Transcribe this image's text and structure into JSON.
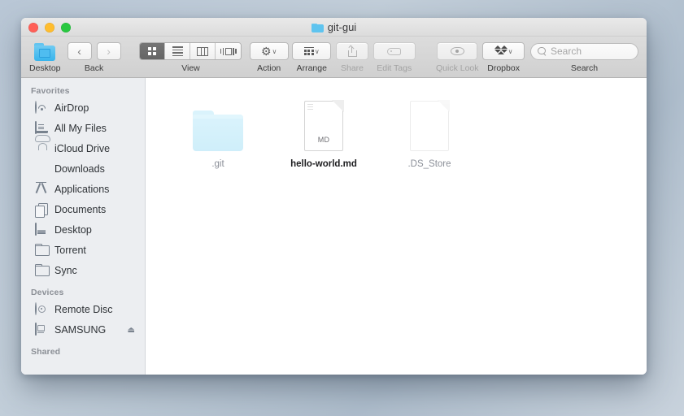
{
  "window": {
    "title": "git-gui",
    "title_icon": "folder-icon",
    "traffic_lights": [
      {
        "name": "close",
        "color": "#ff5f57"
      },
      {
        "name": "minimize",
        "color": "#ffbd2e"
      },
      {
        "name": "zoom",
        "color": "#28c840"
      }
    ]
  },
  "toolbar": {
    "proxy": {
      "label": "Desktop",
      "icon": "folder-icon"
    },
    "nav": {
      "label": "Back",
      "back_icon": "chevron-left-icon",
      "forward_icon": "chevron-right-icon",
      "back_glyph": "‹",
      "forward_glyph": "›"
    },
    "view": {
      "label": "View",
      "options": [
        {
          "name": "icon-view",
          "selected": true
        },
        {
          "name": "list-view",
          "selected": false
        },
        {
          "name": "column-view",
          "selected": false
        },
        {
          "name": "coverflow-view",
          "selected": false
        }
      ]
    },
    "action": {
      "label": "Action",
      "icon": "gear-icon",
      "caret": "∨"
    },
    "arrange": {
      "label": "Arrange",
      "icon": "grid-icon",
      "caret": "∨"
    },
    "share": {
      "label": "Share",
      "icon": "share-icon",
      "disabled": true
    },
    "edit_tags": {
      "label": "Edit Tags",
      "icon": "tag-icon",
      "disabled": true
    },
    "quick_look": {
      "label": "Quick Look",
      "icon": "eye-icon",
      "disabled": true
    },
    "dropbox": {
      "label": "Dropbox",
      "icon": "dropbox-icon",
      "caret": "∨"
    },
    "search": {
      "label": "Search",
      "placeholder": "Search",
      "value": "",
      "icon": "search-icon"
    }
  },
  "sidebar": {
    "sections": [
      {
        "header": "Favorites",
        "items": [
          {
            "label": "AirDrop",
            "icon": "airdrop-icon"
          },
          {
            "label": "All My Files",
            "icon": "all-my-files-icon"
          },
          {
            "label": "iCloud Drive",
            "icon": "cloud-icon"
          },
          {
            "label": "Downloads",
            "icon": "download-icon"
          },
          {
            "label": "Applications",
            "icon": "applications-icon"
          },
          {
            "label": "Documents",
            "icon": "documents-icon"
          },
          {
            "label": "Desktop",
            "icon": "desktop-icon"
          },
          {
            "label": "Torrent",
            "icon": "folder-icon"
          },
          {
            "label": "Sync",
            "icon": "folder-icon"
          }
        ]
      },
      {
        "header": "Devices",
        "items": [
          {
            "label": "Remote Disc",
            "icon": "disc-icon"
          },
          {
            "label": "SAMSUNG",
            "icon": "hard-drive-icon",
            "eject": "⏏"
          }
        ]
      },
      {
        "header": "Shared",
        "items": []
      }
    ]
  },
  "content": {
    "files": [
      {
        "name": ".git",
        "kind": "folder",
        "hidden": true,
        "ext_label": ""
      },
      {
        "name": "hello-world.md",
        "kind": "document",
        "hidden": false,
        "ext_label": "MD"
      },
      {
        "name": ".DS_Store",
        "kind": "document",
        "hidden": true,
        "ext_label": ""
      }
    ]
  },
  "colors": {
    "desktop_background": "#bcc9d7",
    "sidebar_background": "#eceef1",
    "toolbar_background": "#d6d6d6",
    "folder_blue": "#8ed9f4",
    "selected_segment": "#6b6b6b"
  }
}
